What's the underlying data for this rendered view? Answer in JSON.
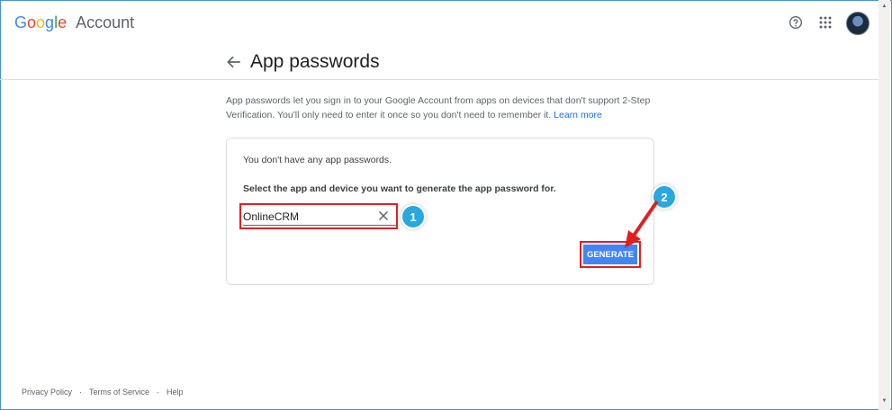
{
  "header": {
    "logo_google": [
      "G",
      "o",
      "o",
      "g",
      "l",
      "e"
    ],
    "logo_account": "Account",
    "help_icon": "help-circle-icon",
    "apps_icon": "apps-grid-icon"
  },
  "page": {
    "title": "App passwords",
    "description": "App passwords let you sign in to your Google Account from apps on devices that don't support 2-Step Verification. You'll only need to enter it once so you don't need to remember it.",
    "learn_more": "Learn more"
  },
  "card": {
    "no_passwords": "You don't have any app passwords.",
    "select_label": "Select the app and device you want to generate the app password for.",
    "app_input_value": "OnlineCRM",
    "generate_label": "GENERATE"
  },
  "annotations": {
    "step1": "1",
    "step2": "2",
    "highlight_color": "#e02020",
    "badge_color": "#29a8df"
  },
  "footer": {
    "privacy": "Privacy Policy",
    "terms": "Terms of Service",
    "help": "Help",
    "separator": "·"
  },
  "colors": {
    "primary": "#1a73e8",
    "button": "#4285f4"
  }
}
